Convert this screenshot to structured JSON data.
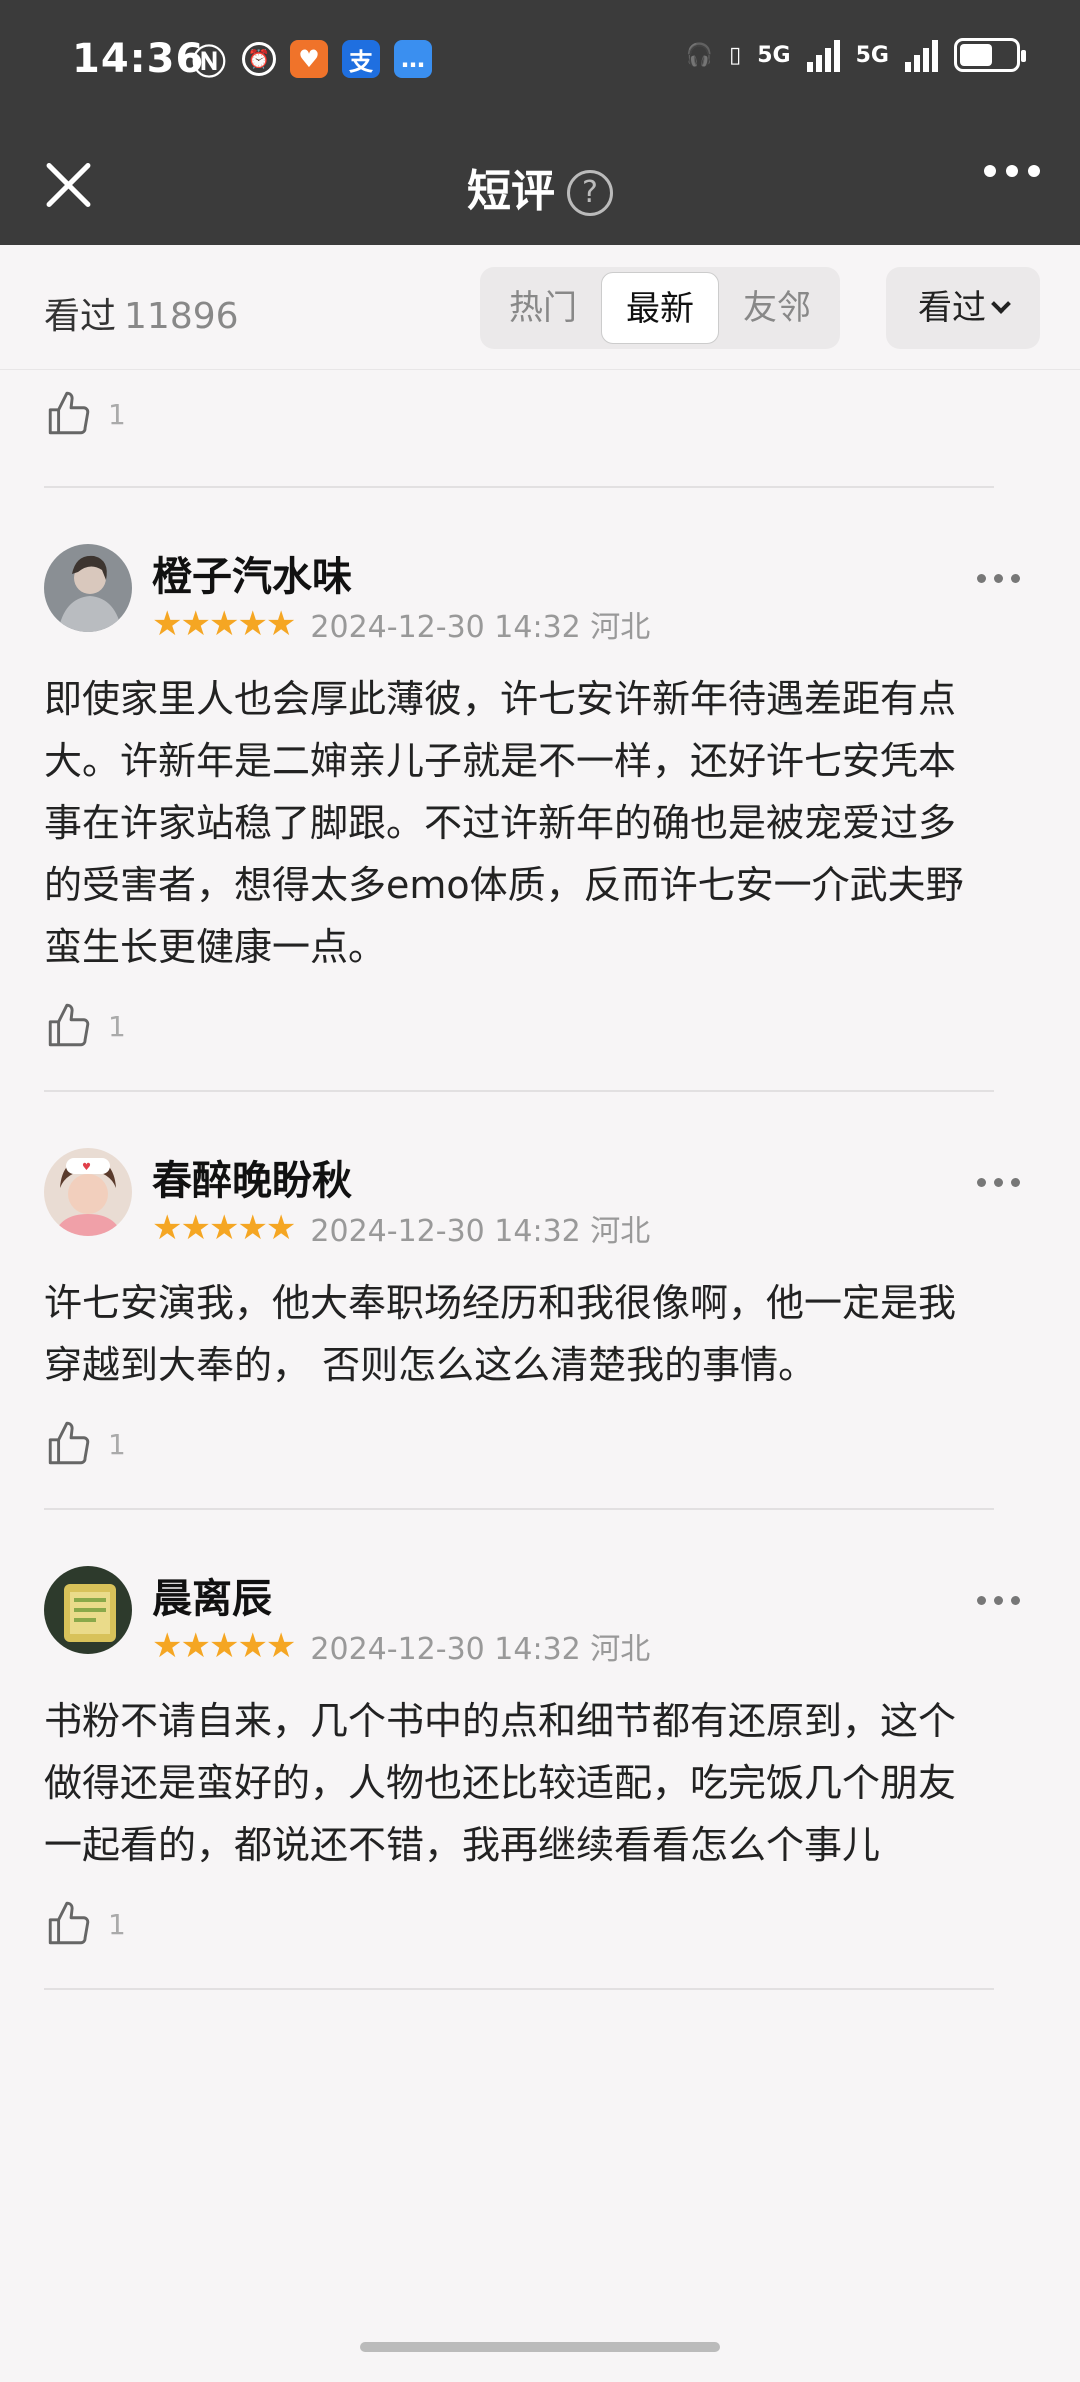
{
  "status_bar": {
    "time": "14:36",
    "icons": [
      "nfc-icon",
      "alarm-icon",
      "taobao-app-icon",
      "alipay-app-icon",
      "message-app-icon"
    ],
    "alipay_glyph": "支",
    "network_1": "5G",
    "network_2": "5G",
    "battery_level": 0.6
  },
  "header": {
    "title": "短评",
    "help_glyph": "?"
  },
  "filter_bar": {
    "seen_label": "看过",
    "seen_count": "11896",
    "segments": [
      "热门",
      "最新",
      "友邻"
    ],
    "active_segment": "最新",
    "sort_label": "看过"
  },
  "top_partial": {
    "like_count": "1"
  },
  "reviews": [
    {
      "username": "橙子汽水味",
      "rating": "★★★★★",
      "date_location": "2024-12-30 14:32 河北",
      "body": "即使家里人也会厚此薄彼，许七安许新年待遇差距有点大。许新年是二婶亲儿子就是不一样，还好许七安凭本事在许家站稳了脚跟。不过许新年的确也是被宠爱过多的受害者，想得太多emo体质，反而许七安一介武夫野蛮生长更健康一点。",
      "like_count": "1"
    },
    {
      "username": "春醉晚盼秋",
      "rating": "★★★★★",
      "date_location": "2024-12-30 14:32 河北",
      "body": "许七安演我，他大奉职场经历和我很像啊，他一定是我穿越到大奉的， 否则怎么这么清楚我的事情。",
      "like_count": "1"
    },
    {
      "username": "晨离辰",
      "rating": "★★★★★",
      "date_location": "2024-12-30 14:32 河北",
      "body": "书粉不请自来，几个书中的点和细节都有还原到，这个做得还是蛮好的，人物也还比较适配，吃完饭几个朋友一起看的，都说还不错，我再继续看看怎么个事儿",
      "like_count": "1"
    }
  ]
}
